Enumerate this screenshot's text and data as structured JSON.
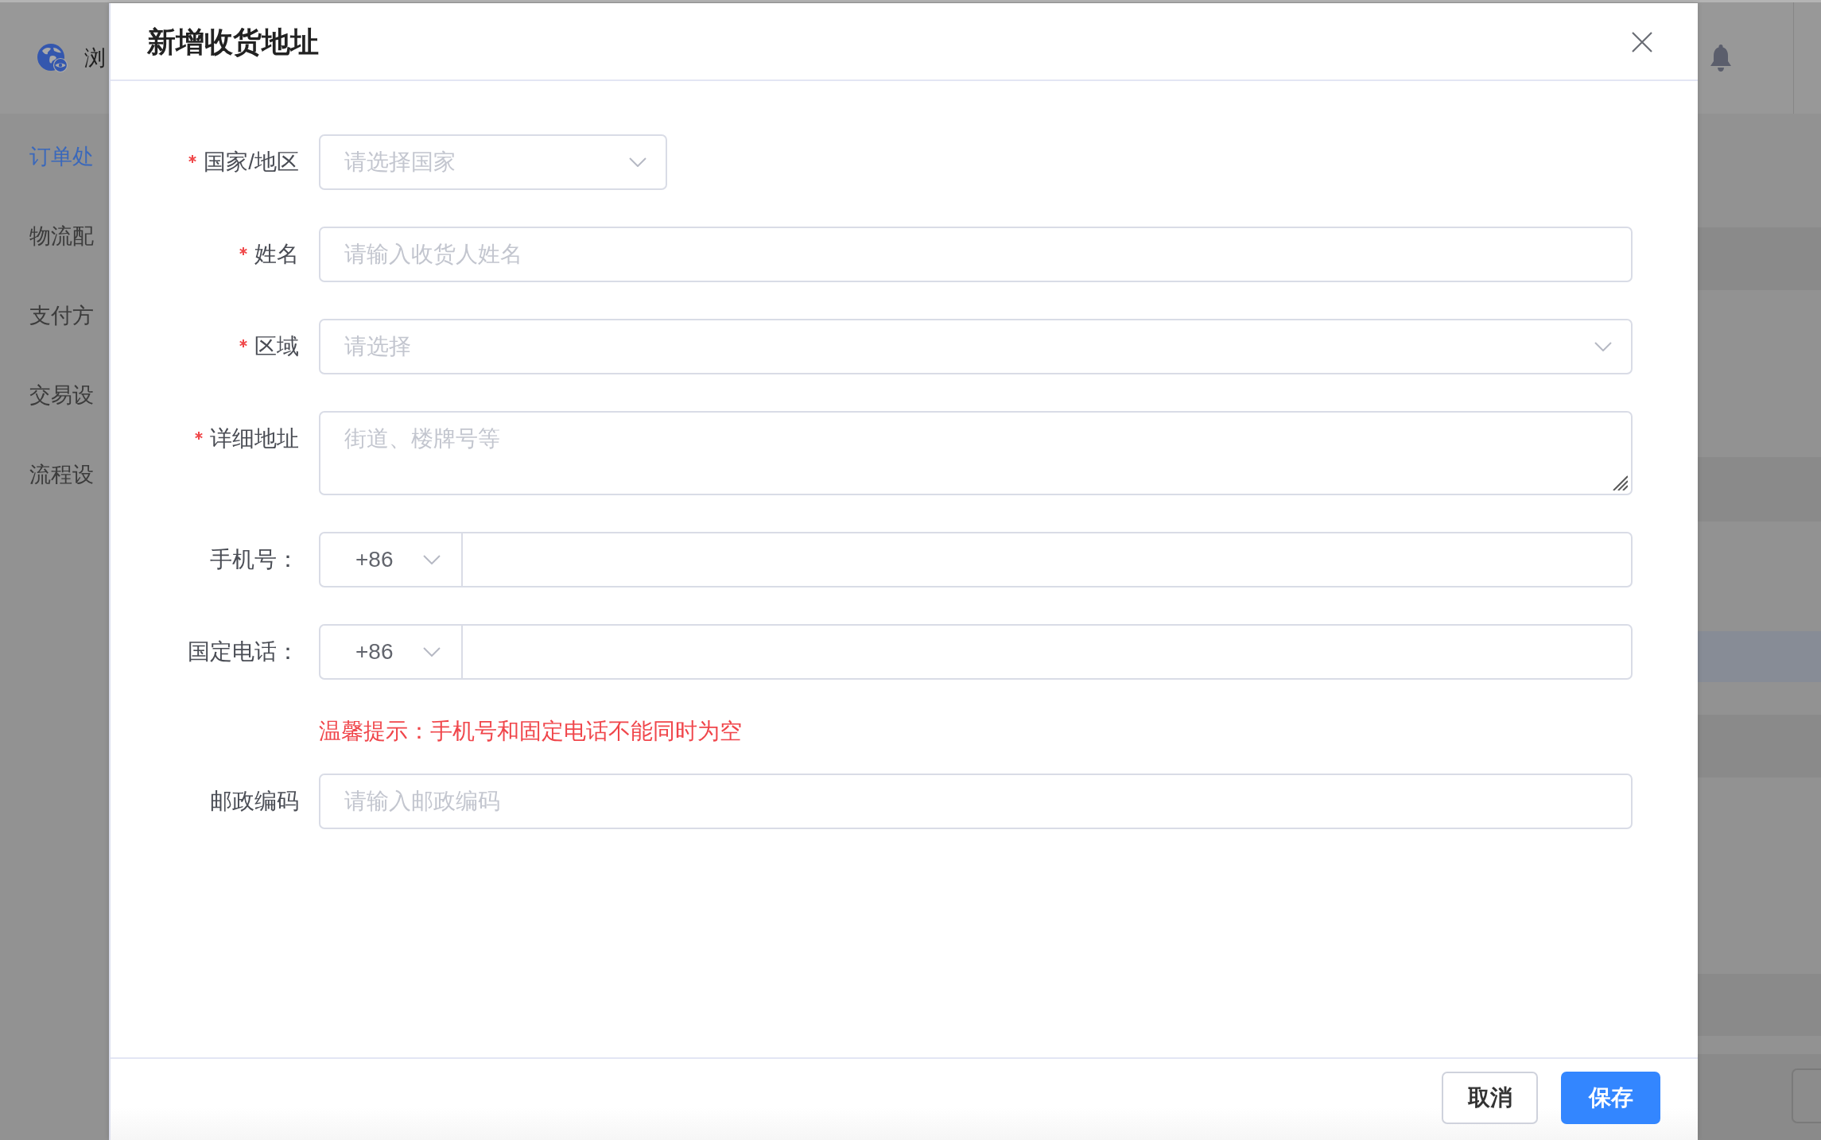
{
  "background_page": {
    "header": {
      "brand_text": "浏"
    },
    "sidebar": {
      "items": [
        {
          "label": "订单处",
          "selected": true
        },
        {
          "label": "物流配",
          "selected": false
        },
        {
          "label": "支付方",
          "selected": false
        },
        {
          "label": "交易设",
          "selected": false
        },
        {
          "label": "流程设",
          "selected": false
        }
      ]
    },
    "content": {
      "rows": [
        {
          "selected": false
        },
        {
          "selected": false
        },
        {
          "selected": true
        },
        {
          "selected": false
        },
        {
          "selected": false
        }
      ]
    }
  },
  "dialog": {
    "title": "新增收货地址",
    "fields": [
      {
        "kind": "select",
        "label": "国家/地区",
        "required": true,
        "placeholder": "请选择国家"
      },
      {
        "kind": "text",
        "label": "姓名",
        "required": true,
        "placeholder": "请输入收货人姓名"
      },
      {
        "kind": "select",
        "label": "区域",
        "required": true,
        "placeholder": "请选择"
      },
      {
        "kind": "textarea",
        "label": "详细地址",
        "required": true,
        "placeholder": "街道、楼牌号等"
      },
      {
        "kind": "phone",
        "label": "手机号：",
        "required": false,
        "prefix": "+86"
      },
      {
        "kind": "phone",
        "label": "国定电话：",
        "required": false,
        "prefix": "+86"
      },
      {
        "kind": "hint",
        "text": "温馨提示：手机号和固定电话不能同时为空"
      },
      {
        "kind": "text",
        "label": "邮政编码",
        "required": false,
        "placeholder": "请输入邮政编码"
      }
    ],
    "buttons": [
      {
        "kind": "default",
        "label": "取消"
      },
      {
        "kind": "primary",
        "label": "保存"
      }
    ]
  }
}
